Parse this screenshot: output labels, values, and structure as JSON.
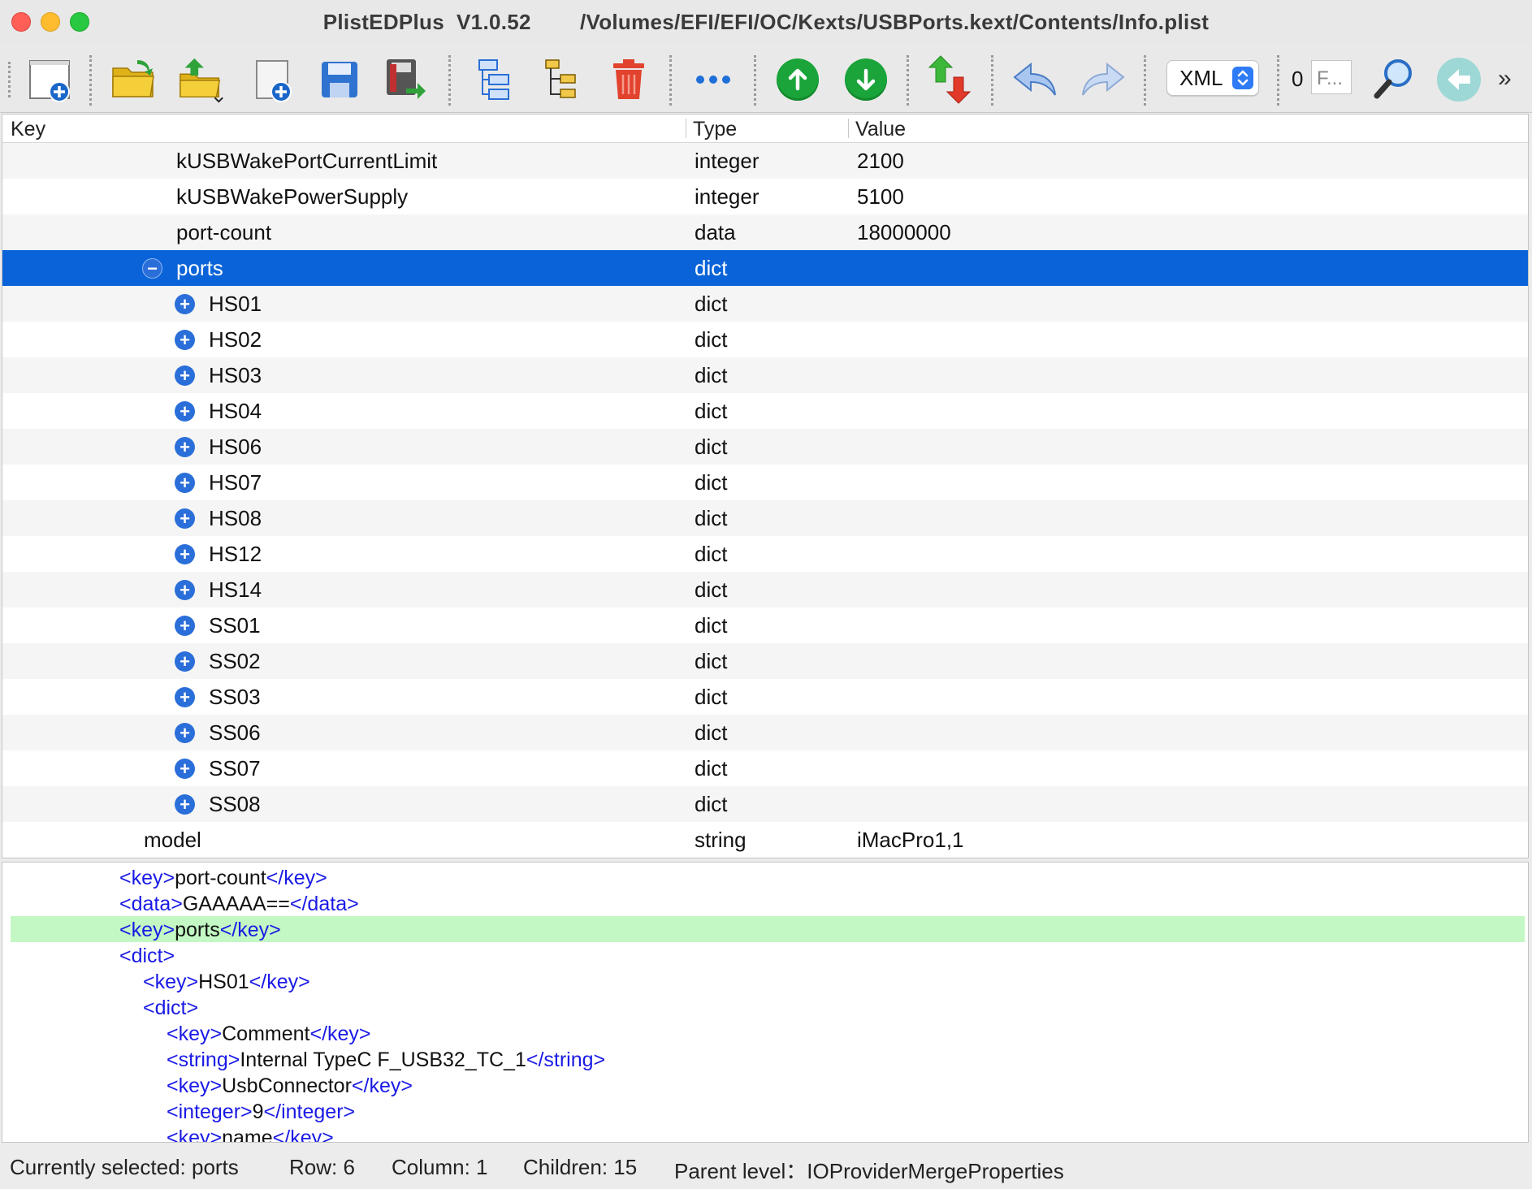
{
  "window": {
    "app_title": "PlistEDPlus  V1.0.52",
    "file_path": "/Volumes/EFI/EFI/OC/Kexts/USBPorts.kext/Contents/Info.plist"
  },
  "toolbar": {
    "format_select_value": "XML",
    "find_count": "0",
    "find_placeholder": "F...",
    "overflow_label": "»",
    "icons": [
      "new-document-icon",
      "open-folder-icon",
      "open-recent-icon",
      "new-item-icon",
      "save-icon",
      "save-as-icon",
      "expand-tree-icon",
      "collapse-tree-icon",
      "delete-icon",
      "more-icon",
      "move-up-icon",
      "move-down-icon",
      "sort-icon",
      "undo-icon",
      "redo-icon",
      "find-icon",
      "back-icon"
    ]
  },
  "table": {
    "columns": {
      "key": "Key",
      "type": "Type",
      "value": "Value"
    },
    "rows": [
      {
        "key": "kUSBWakePortCurrentLimit",
        "type": "integer",
        "value": "2100",
        "expander": ""
      },
      {
        "key": "kUSBWakePowerSupply",
        "type": "integer",
        "value": "5100",
        "expander": ""
      },
      {
        "key": "port-count",
        "type": "data",
        "value": "18000000",
        "expander": ""
      },
      {
        "key": "ports",
        "type": "dict",
        "value": "",
        "expander": "−"
      },
      {
        "key": "HS01",
        "type": "dict",
        "value": "",
        "expander": "+"
      },
      {
        "key": "HS02",
        "type": "dict",
        "value": "",
        "expander": "+"
      },
      {
        "key": "HS03",
        "type": "dict",
        "value": "",
        "expander": "+"
      },
      {
        "key": "HS04",
        "type": "dict",
        "value": "",
        "expander": "+"
      },
      {
        "key": "HS06",
        "type": "dict",
        "value": "",
        "expander": "+"
      },
      {
        "key": "HS07",
        "type": "dict",
        "value": "",
        "expander": "+"
      },
      {
        "key": "HS08",
        "type": "dict",
        "value": "",
        "expander": "+"
      },
      {
        "key": "HS12",
        "type": "dict",
        "value": "",
        "expander": "+"
      },
      {
        "key": "HS14",
        "type": "dict",
        "value": "",
        "expander": "+"
      },
      {
        "key": "SS01",
        "type": "dict",
        "value": "",
        "expander": "+"
      },
      {
        "key": "SS02",
        "type": "dict",
        "value": "",
        "expander": "+"
      },
      {
        "key": "SS03",
        "type": "dict",
        "value": "",
        "expander": "+"
      },
      {
        "key": "SS06",
        "type": "dict",
        "value": "",
        "expander": "+"
      },
      {
        "key": "SS07",
        "type": "dict",
        "value": "",
        "expander": "+"
      },
      {
        "key": "SS08",
        "type": "dict",
        "value": "",
        "expander": "+"
      },
      {
        "key": "model",
        "type": "string",
        "value": "iMacPro1,1",
        "expander": ""
      }
    ]
  },
  "source": {
    "lines": [
      {
        "open": "<key>",
        "text": "port-count",
        "close": "</key>"
      },
      {
        "open": "<data>",
        "text": "GAAAAA==",
        "close": "</data>"
      },
      {
        "open": "<key>",
        "text": "ports",
        "close": "</key>"
      },
      {
        "open": "<dict>",
        "text": "",
        "close": ""
      },
      {
        "open": "<key>",
        "text": "HS01",
        "close": "</key>"
      },
      {
        "open": "<dict>",
        "text": "",
        "close": ""
      },
      {
        "open": "<key>",
        "text": "Comment",
        "close": "</key>"
      },
      {
        "open": "<string>",
        "text": "Internal TypeC F_USB32_TC_1",
        "close": "</string>"
      },
      {
        "open": "<key>",
        "text": "UsbConnector",
        "close": "</key>"
      },
      {
        "open": "<integer>",
        "text": "9",
        "close": "</integer>"
      },
      {
        "open": "<key>",
        "text": "name",
        "close": "</key>"
      }
    ]
  },
  "status": {
    "selected": "Currently selected: ports",
    "row": "Row: 6",
    "column": "Column: 1",
    "children": "Children: 15",
    "parent": "Parent level：IOProviderMergeProperties"
  }
}
